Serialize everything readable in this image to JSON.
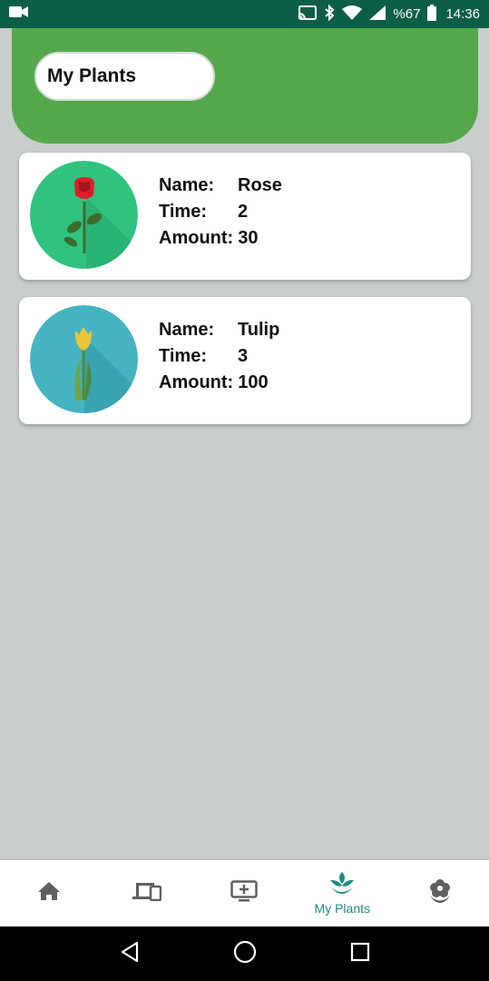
{
  "status_bar": {
    "battery": "%67",
    "time": "14:36",
    "icons": [
      "video-camera-icon",
      "cast-icon",
      "bluetooth-icon",
      "wifi-icon",
      "signal-icon",
      "battery-icon"
    ]
  },
  "header": {
    "title": "My Plants"
  },
  "plants": [
    {
      "name_label": "Name:",
      "name": "Rose",
      "time_label": "Time:",
      "time": "2",
      "amount_label": "Amount:",
      "amount": "30",
      "icon": "rose-icon",
      "circle_color": "#2fc37f"
    },
    {
      "name_label": "Name:",
      "name": "Tulip",
      "time_label": "Time:",
      "time": "3",
      "amount_label": "Amount:",
      "amount": "100",
      "icon": "tulip-icon",
      "circle_color": "#46b3c3"
    }
  ],
  "bottom_nav": {
    "items": [
      {
        "icon": "home-icon",
        "label": ""
      },
      {
        "icon": "devices-icon",
        "label": ""
      },
      {
        "icon": "add-screen-icon",
        "label": ""
      },
      {
        "icon": "plant-icon",
        "label": "My Plants",
        "active": true
      },
      {
        "icon": "flower-icon",
        "label": ""
      }
    ],
    "active_color": "#1d8c7e",
    "inactive_color": "#5f5f5f"
  },
  "system_nav": [
    "back-icon",
    "home-circle-icon",
    "recents-icon"
  ]
}
